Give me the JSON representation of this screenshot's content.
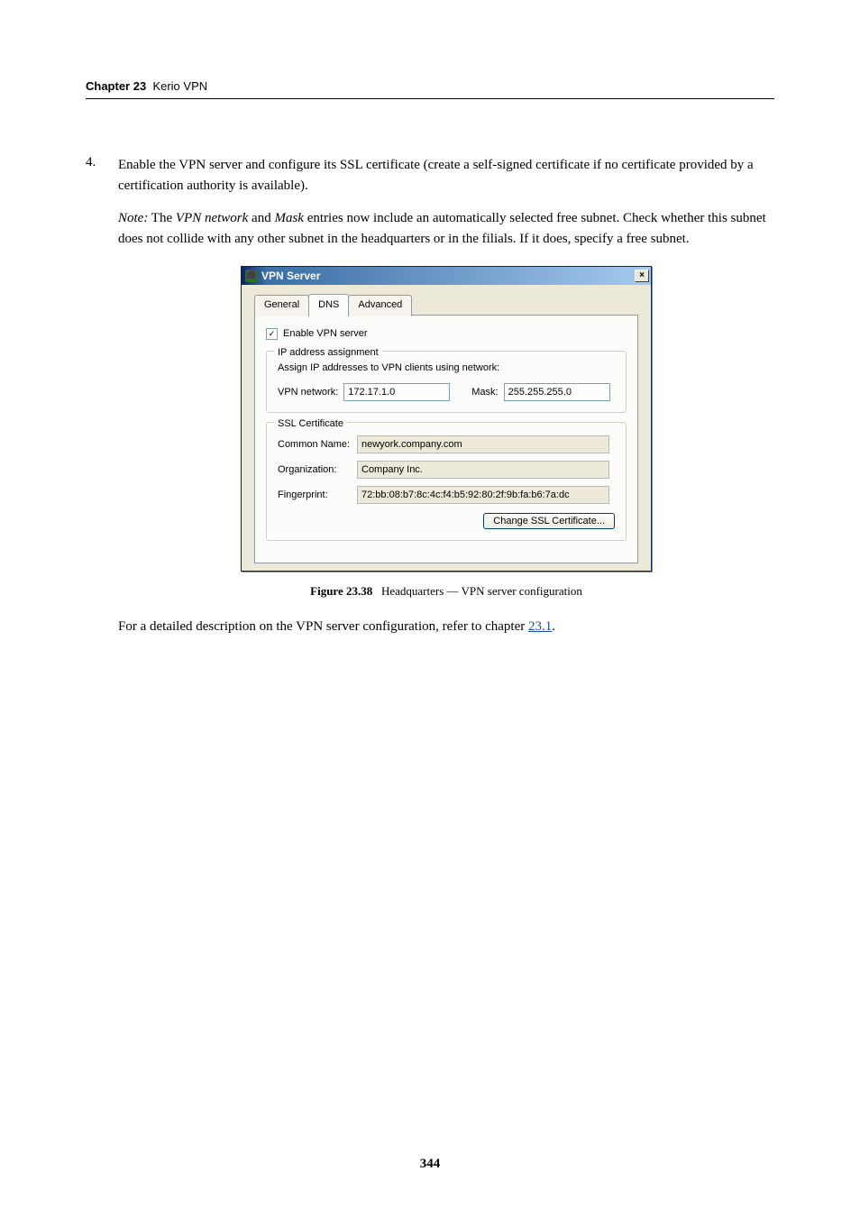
{
  "header": {
    "chapter_label": "Chapter 23",
    "chapter_title": "Kerio VPN"
  },
  "list": {
    "num": "4.",
    "para1": "Enable the VPN server and configure its SSL certificate (create a self-signed certificate if no certificate provided by a certification authority is available).",
    "note_label": "Note:",
    "note_body_pre": " The ",
    "note_italic1": "VPN network",
    "note_mid": " and ",
    "note_italic2": "Mask",
    "note_body_post": " entries now include an automatically selected free subnet. Check whether this subnet does not collide with any other subnet in the headquarters or in the filials. If it does, specify a free subnet."
  },
  "dialog": {
    "title": "VPN Server",
    "close_glyph": "×",
    "tabs": {
      "general": "General",
      "dns": "DNS",
      "advanced": "Advanced"
    },
    "enable_label": "Enable VPN server",
    "check_glyph": "✓",
    "ip_group": {
      "legend": "IP address assignment",
      "desc": "Assign IP addresses to VPN clients using network:",
      "vpn_network_label": "VPN network:",
      "vpn_network_value": "172.17.1.0",
      "mask_label": "Mask:",
      "mask_value": "255.255.255.0"
    },
    "ssl_group": {
      "legend": "SSL Certificate",
      "common_name_label": "Common Name:",
      "common_name_value": "newyork.company.com",
      "org_label": "Organization:",
      "org_value": "Company Inc.",
      "fp_label": "Fingerprint:",
      "fp_value": "72:bb:08:b7:8c:4c:f4:b5:92:80:2f:9b:fa:b6:7a:dc",
      "change_btn": "Change SSL Certificate..."
    }
  },
  "figure": {
    "label": "Figure 23.38",
    "caption": "Headquarters — VPN server configuration"
  },
  "closing": {
    "pre": "For a detailed description on the VPN server configuration, refer to chapter ",
    "link": "23.1",
    "post": "."
  },
  "page_number": "344"
}
